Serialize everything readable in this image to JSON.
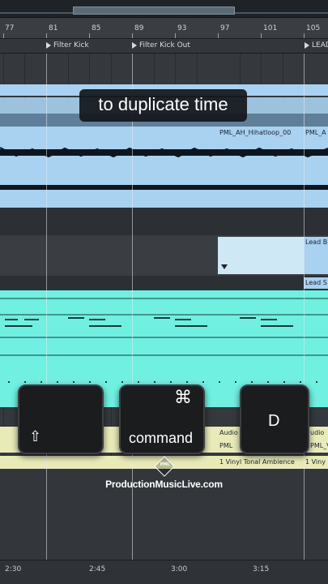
{
  "ruler": {
    "bars": [
      "77",
      "81",
      "85",
      "89",
      "93",
      "97",
      "101",
      "105"
    ]
  },
  "locators": {
    "filter_kick": "Filter Kick",
    "filter_kick_out": "Filter Kick Out",
    "lead": "LEAD"
  },
  "clips": {
    "hihatloop": "PML_AH_Hihatloop_00",
    "hihatloop_next": "PML_A",
    "lead_b": "Lead B",
    "lead_s": "Lead S",
    "audio_1": "Audio",
    "audio_2": "udio",
    "pml_1": "PML",
    "pml_2": "PML_V",
    "vinyl_1": "1 Vinyl Tonal Ambience",
    "vinyl_2": "1 Viny"
  },
  "caption": "to duplicate time",
  "keys": {
    "shift": {
      "symbol": "⇧"
    },
    "command": {
      "symbol": "⌘",
      "label": "command"
    },
    "d": {
      "label": "D"
    }
  },
  "brand": {
    "logo_text": "PML",
    "name": "ProductionMusicLive.com"
  },
  "timebar": {
    "times": [
      "2:30",
      "2:45",
      "3:00",
      "3:15"
    ]
  },
  "colors": {
    "light_blue": "#a9d1f0",
    "cyan": "#6ff0e0",
    "cream": "#e8eab8",
    "caption_bg": "#14161a"
  }
}
